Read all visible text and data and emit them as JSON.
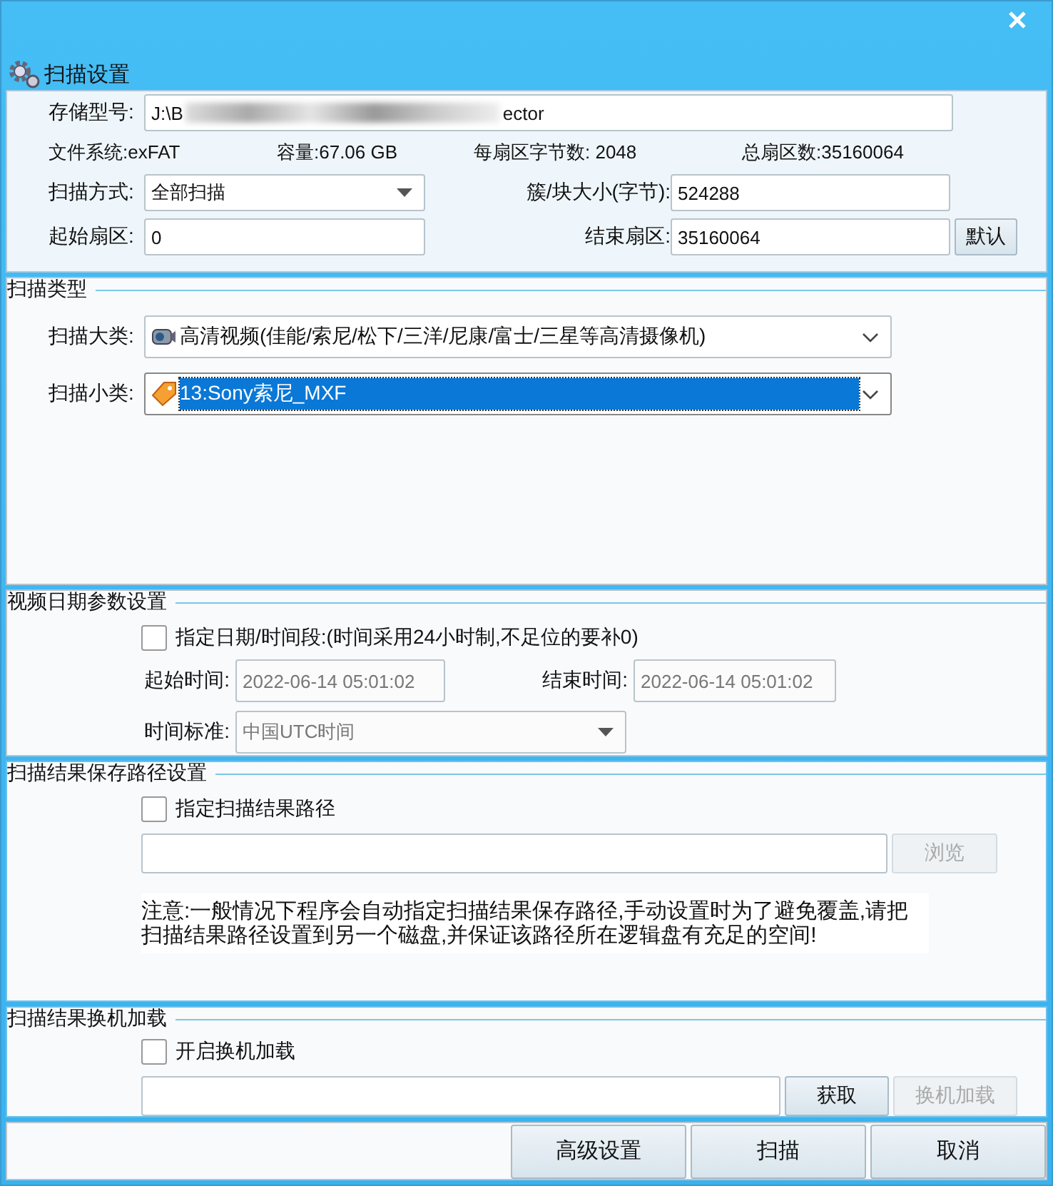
{
  "window": {
    "title": "扫描设置"
  },
  "storage": {
    "label": "存储型号:",
    "value_start": "J:\\B",
    "value_end": "ector",
    "redacted": true
  },
  "info": [
    {
      "text": "文件系统:exFAT"
    },
    {
      "text": "容量:67.06 GB"
    },
    {
      "text": "每扇区字节数: 2048"
    },
    {
      "text": "总扇区数:35160064"
    }
  ],
  "scan_mode": {
    "label": "扫描方式:",
    "value": "全部扫描"
  },
  "cluster_size": {
    "label": "簇/块大小(字节):",
    "value": "524288"
  },
  "start_sector": {
    "label": "起始扇区:",
    "value": "0"
  },
  "end_sector": {
    "label": "结束扇区:",
    "value": "35160064"
  },
  "default_button": "默认",
  "scan_type": {
    "legend": "扫描类型",
    "combos": [
      {
        "label": "扫描大类:",
        "value": "高清视频(佳能/索尼/松下/三洋/尼康/富士/三星等高清摄像机)",
        "kind": "camera",
        "focused": false
      },
      {
        "label": "扫描小类:",
        "value": "13:Sony索尼_MXF",
        "kind": "tag",
        "focused": true
      }
    ]
  },
  "date_settings": {
    "legend": "视频日期参数设置",
    "checkbox": {
      "label": "指定日期/时间段:(时间采用24小时制,不足位的要补0)",
      "checked": false
    },
    "start": {
      "label": "起始时间:",
      "value": "2022-06-14 05:01:02",
      "disabled": true
    },
    "end": {
      "label": "结束时间:",
      "value": "2022-06-14 05:01:02",
      "disabled": true
    },
    "standard": {
      "label": "时间标准:",
      "value": "中国UTC时间",
      "disabled": true
    }
  },
  "save_path": {
    "legend": "扫描结果保存路径设置",
    "checkbox": {
      "label": "指定扫描结果路径",
      "checked": false
    },
    "browse": {
      "label": "浏览",
      "disabled": true
    },
    "note": "注意:一般情况下程序会自动指定扫描结果保存路径,手动设置时为了避免覆盖,请把扫描结果路径设置到另一个磁盘,并保证该路径所在逻辑盘有充足的空间!"
  },
  "reload": {
    "legend": "扫描结果换机加载",
    "checkbox": {
      "label": "开启换机加载",
      "checked": false
    },
    "buttons": [
      {
        "label": "获取",
        "disabled": false
      },
      {
        "label": "换机加载",
        "disabled": true
      }
    ]
  },
  "footer_buttons": [
    {
      "label": "高级设置"
    },
    {
      "label": "扫描"
    },
    {
      "label": "取消"
    }
  ]
}
